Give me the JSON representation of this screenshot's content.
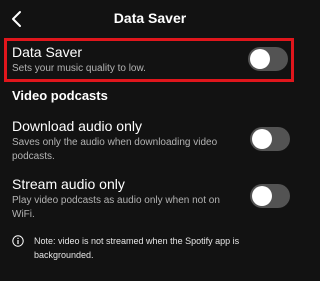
{
  "header": {
    "title": "Data Saver"
  },
  "data_saver": {
    "label": "Data Saver",
    "description": "Sets your music quality to low.",
    "enabled": false
  },
  "video_section": {
    "heading": "Video podcasts"
  },
  "download_audio_only": {
    "label": "Download audio only",
    "description": "Saves only the audio when downloading video podcasts.",
    "enabled": false
  },
  "stream_audio_only": {
    "label": "Stream audio only",
    "description": "Play video podcasts as audio only when not on WiFi.",
    "enabled": false
  },
  "note": {
    "text": "Note: video is not streamed when the Spotify app is backgrounded."
  },
  "colors": {
    "background": "#121212",
    "highlight": "#e0161c",
    "toggle_off": "#535353",
    "subtext": "#b3b3b3"
  }
}
